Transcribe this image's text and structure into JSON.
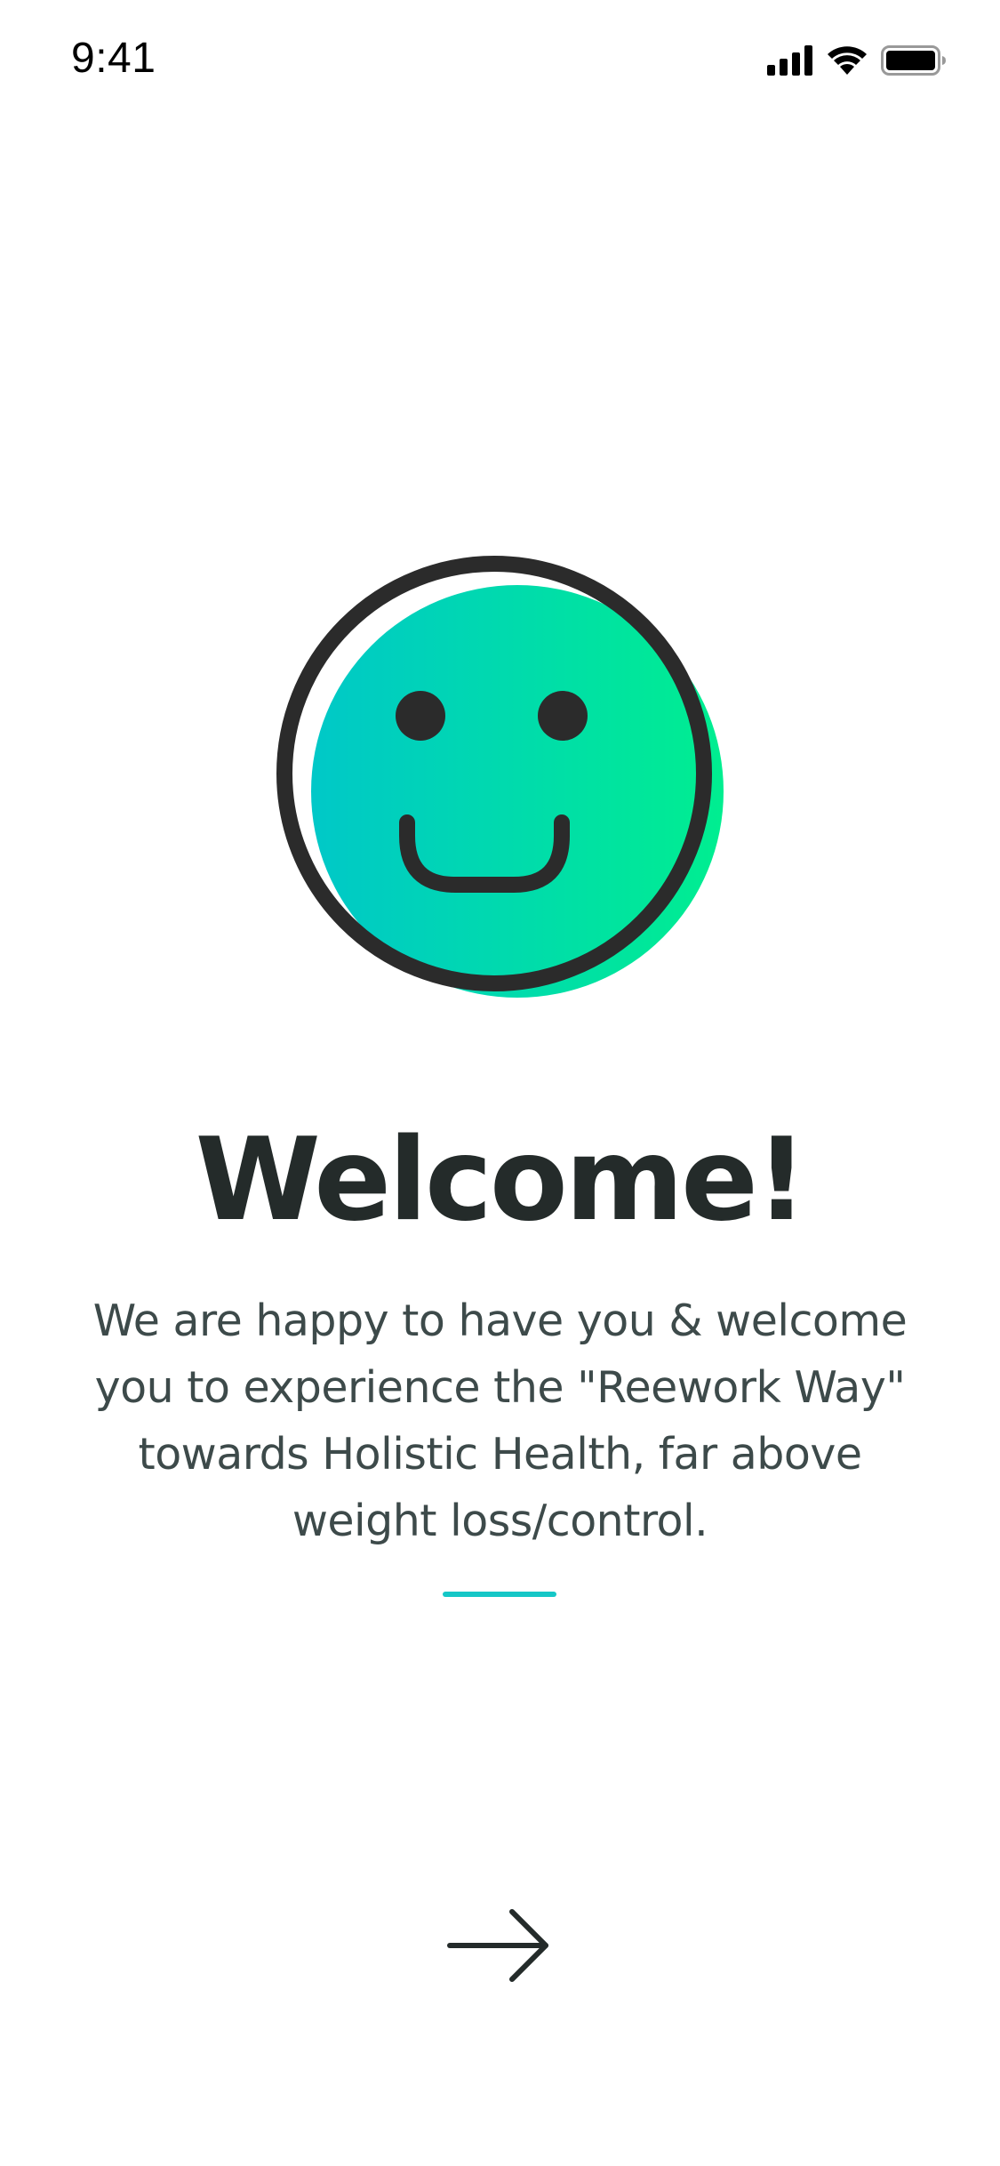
{
  "status_bar": {
    "time": "9:41",
    "icons": [
      "cellular-signal-icon",
      "wifi-icon",
      "battery-icon"
    ]
  },
  "hero": {
    "icon": "smiley-face-icon",
    "gradient_start": "#00c8c8",
    "gradient_end": "#00ee90",
    "outline_color": "#2b2b2b"
  },
  "welcome": {
    "title": "Welcome!",
    "message_lines": [
      "We are happy to have you & welcome",
      "you to experience the \"Reework Way\"",
      "towards Holistic Health, far above",
      "weight loss/control."
    ]
  },
  "divider_color": "#15c7c7",
  "navigation": {
    "next_icon": "arrow-right-icon"
  }
}
